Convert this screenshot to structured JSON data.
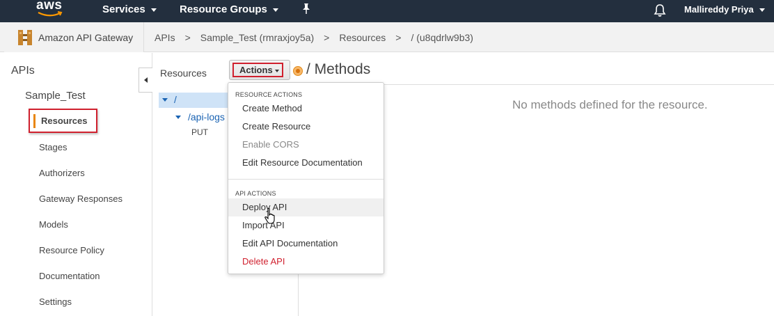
{
  "topnav": {
    "logo_text": "aws",
    "services_label": "Services",
    "resource_groups_label": "Resource Groups",
    "user_name": "Mallireddy Priya"
  },
  "breadcrumb": {
    "service_name": "Amazon API Gateway",
    "items": [
      "APIs",
      "Sample_Test (rmraxjoy5a)",
      "Resources",
      "/ (u8qdrlw9b3)"
    ],
    "separator": ">"
  },
  "sidebar": {
    "apis_label": "APIs",
    "api_name": "Sample_Test",
    "items": [
      {
        "label": "Resources",
        "active": true
      },
      {
        "label": "Stages"
      },
      {
        "label": "Authorizers"
      },
      {
        "label": "Gateway Responses"
      },
      {
        "label": "Models"
      },
      {
        "label": "Resource Policy"
      },
      {
        "label": "Documentation"
      },
      {
        "label": "Settings"
      }
    ]
  },
  "resources_panel": {
    "title": "Resources",
    "actions_label": "Actions",
    "tree": {
      "root": "/",
      "child": "/api-logs",
      "method": "PUT"
    }
  },
  "methods_panel": {
    "title": "/ Methods",
    "empty_message": "No methods defined for the resource."
  },
  "actions_menu": {
    "resource_actions_header": "RESOURCE ACTIONS",
    "resource_actions": [
      "Create Method",
      "Create Resource",
      "Enable CORS",
      "Edit Resource Documentation"
    ],
    "api_actions_header": "API ACTIONS",
    "api_actions": [
      "Deploy API",
      "Import API",
      "Edit API Documentation",
      "Delete API"
    ]
  },
  "colors": {
    "nav_bg": "#232f3e",
    "highlight_red": "#d0202e",
    "active_orange": "#e8860f",
    "link_blue": "#1a63b3"
  }
}
